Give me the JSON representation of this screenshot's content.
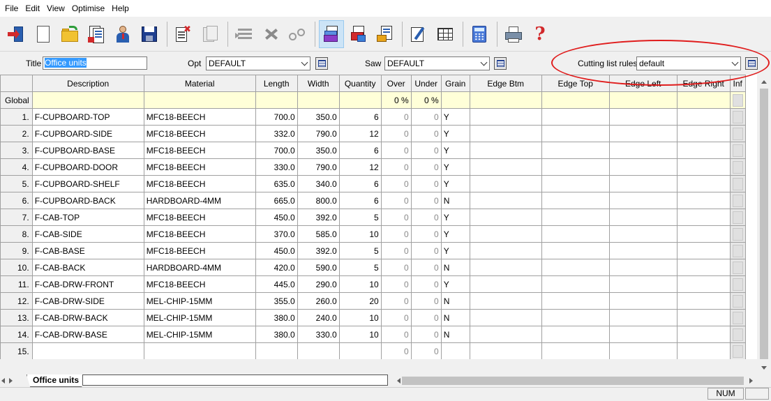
{
  "menu": [
    "File",
    "Edit",
    "View",
    "Optimise",
    "Help"
  ],
  "toolbar": {
    "buttons": [
      {
        "icon": "exit-icon"
      },
      {
        "icon": "new-page-icon"
      },
      {
        "icon": "open-folder-icon"
      },
      {
        "icon": "parts-list-icon"
      },
      {
        "icon": "user-icon"
      },
      {
        "icon": "save-disk-icon"
      },
      {
        "icon": "delete-page-icon"
      },
      {
        "icon": "copy-disabled-icon"
      },
      {
        "icon": "lines-disabled-icon"
      },
      {
        "icon": "cut-disabled-icon"
      },
      {
        "icon": "glasses-disabled-icon"
      },
      {
        "icon": "cutting-list-icon",
        "active": true
      },
      {
        "icon": "sheets-icon"
      },
      {
        "icon": "offcuts-icon"
      },
      {
        "icon": "edit-icon"
      },
      {
        "icon": "table-icon"
      },
      {
        "icon": "calculator-icon"
      },
      {
        "icon": "printer-icon"
      },
      {
        "icon": "help-icon"
      }
    ]
  },
  "options": {
    "title_label": "Title",
    "title_value": "Office units",
    "opt_label": "Opt",
    "opt_value": "DEFAULT",
    "saw_label": "Saw",
    "saw_value": "DEFAULT",
    "rules_label": "Cutting list rules",
    "rules_value": "default"
  },
  "grid": {
    "columns": [
      "Description",
      "Material",
      "Length",
      "Width",
      "Quantity",
      "Over",
      "Under",
      "Grain",
      "Edge Btm",
      "Edge Top",
      "Edge Left",
      "Edge Right",
      "Inf"
    ],
    "global": {
      "label": "Global",
      "over": "0 %",
      "under": "0 %"
    },
    "rows": [
      {
        "n": "1.",
        "desc": "F-CUPBOARD-TOP",
        "mat": "MFC18-BEECH",
        "len": "700.0",
        "wid": "350.0",
        "qty": "6",
        "over": "0",
        "under": "0",
        "grain": "Y"
      },
      {
        "n": "2.",
        "desc": "F-CUPBOARD-SIDE",
        "mat": "MFC18-BEECH",
        "len": "332.0",
        "wid": "790.0",
        "qty": "12",
        "over": "0",
        "under": "0",
        "grain": "Y"
      },
      {
        "n": "3.",
        "desc": "F-CUPBOARD-BASE",
        "mat": "MFC18-BEECH",
        "len": "700.0",
        "wid": "350.0",
        "qty": "6",
        "over": "0",
        "under": "0",
        "grain": "Y"
      },
      {
        "n": "4.",
        "desc": "F-CUPBOARD-DOOR",
        "mat": "MFC18-BEECH",
        "len": "330.0",
        "wid": "790.0",
        "qty": "12",
        "over": "0",
        "under": "0",
        "grain": "Y"
      },
      {
        "n": "5.",
        "desc": "F-CUPBOARD-SHELF",
        "mat": "MFC18-BEECH",
        "len": "635.0",
        "wid": "340.0",
        "qty": "6",
        "over": "0",
        "under": "0",
        "grain": "Y"
      },
      {
        "n": "6.",
        "desc": "F-CUPBOARD-BACK",
        "mat": "HARDBOARD-4MM",
        "len": "665.0",
        "wid": "800.0",
        "qty": "6",
        "over": "0",
        "under": "0",
        "grain": "N"
      },
      {
        "n": "7.",
        "desc": "F-CAB-TOP",
        "mat": "MFC18-BEECH",
        "len": "450.0",
        "wid": "392.0",
        "qty": "5",
        "over": "0",
        "under": "0",
        "grain": "Y"
      },
      {
        "n": "8.",
        "desc": "F-CAB-SIDE",
        "mat": "MFC18-BEECH",
        "len": "370.0",
        "wid": "585.0",
        "qty": "10",
        "over": "0",
        "under": "0",
        "grain": "Y"
      },
      {
        "n": "9.",
        "desc": "F-CAB-BASE",
        "mat": "MFC18-BEECH",
        "len": "450.0",
        "wid": "392.0",
        "qty": "5",
        "over": "0",
        "under": "0",
        "grain": "Y"
      },
      {
        "n": "10.",
        "desc": "F-CAB-BACK",
        "mat": "HARDBOARD-4MM",
        "len": "420.0",
        "wid": "590.0",
        "qty": "5",
        "over": "0",
        "under": "0",
        "grain": "N"
      },
      {
        "n": "11.",
        "desc": "F-CAB-DRW-FRONT",
        "mat": "MFC18-BEECH",
        "len": "445.0",
        "wid": "290.0",
        "qty": "10",
        "over": "0",
        "under": "0",
        "grain": "Y"
      },
      {
        "n": "12.",
        "desc": "F-CAB-DRW-SIDE",
        "mat": "MEL-CHIP-15MM",
        "len": "355.0",
        "wid": "260.0",
        "qty": "20",
        "over": "0",
        "under": "0",
        "grain": "N"
      },
      {
        "n": "13.",
        "desc": "F-CAB-DRW-BACK",
        "mat": "MEL-CHIP-15MM",
        "len": "380.0",
        "wid": "240.0",
        "qty": "10",
        "over": "0",
        "under": "0",
        "grain": "N"
      },
      {
        "n": "14.",
        "desc": "F-CAB-DRW-BASE",
        "mat": "MEL-CHIP-15MM",
        "len": "380.0",
        "wid": "330.0",
        "qty": "10",
        "over": "0",
        "under": "0",
        "grain": "N"
      },
      {
        "n": "15.",
        "desc": "",
        "mat": "",
        "len": "",
        "wid": "",
        "qty": "",
        "over": "0",
        "under": "0",
        "grain": ""
      }
    ]
  },
  "sheet_tab": "Office units",
  "status": {
    "num": "NUM"
  },
  "colors": {
    "highlight_ellipse": "#e01d1d",
    "global_row": "#ffffd8",
    "selection": "#3399ff"
  }
}
